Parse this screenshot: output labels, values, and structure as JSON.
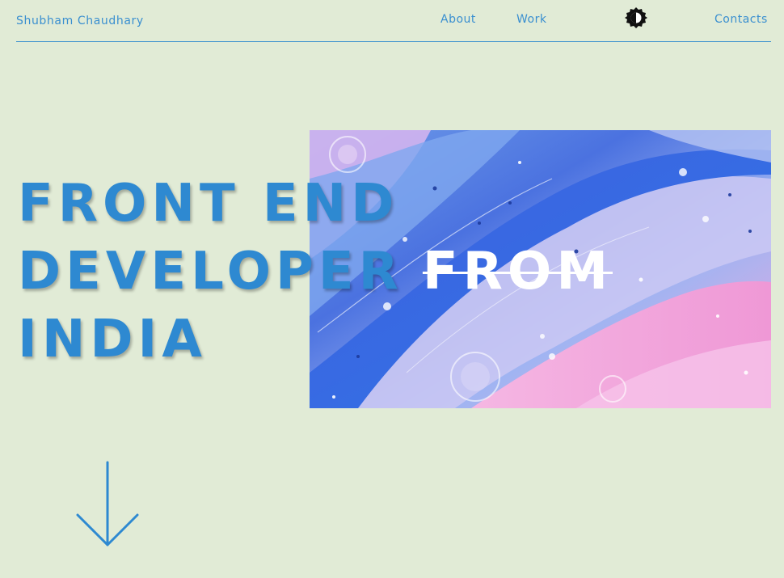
{
  "header": {
    "brand": "Shubham Chaudhary",
    "nav": {
      "about": "About",
      "work": "Work",
      "contacts": "Contacts"
    },
    "theme_toggle_icon": "contrast-icon"
  },
  "hero": {
    "line1": "FRONT END",
    "line2": "DEVELOPER",
    "from_word": "FROM",
    "line3": "INDIA",
    "image_icon": "fluid-art-image",
    "scroll_icon": "arrow-down-icon"
  },
  "colors": {
    "background": "#e1ebd6",
    "accent": "#2e89d1",
    "image_blue": "#3f63e0",
    "image_pink": "#f1a3dc"
  }
}
